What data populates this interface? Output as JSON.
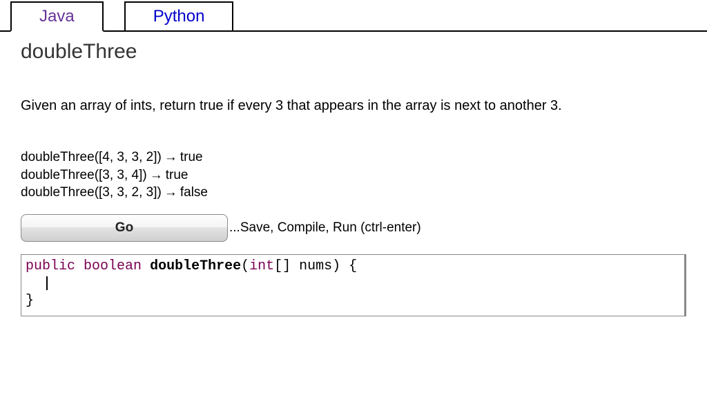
{
  "tabs": {
    "java": "Java",
    "python": "Python"
  },
  "title": "doubleThree",
  "description": "Given an array of ints, return true if every 3 that appears in the array is next to another 3.",
  "examples": [
    {
      "call": "doubleThree([4, 3, 3, 2])",
      "result": "true"
    },
    {
      "call": "doubleThree([3, 3, 4])",
      "result": "true"
    },
    {
      "call": "doubleThree([3, 3, 2, 3])",
      "result": "false"
    }
  ],
  "arrow": "→",
  "go_button": "Go",
  "hint": "...Save, Compile, Run (ctrl-enter)",
  "code": {
    "kw_public": "public",
    "kw_boolean": "boolean",
    "method_name": "doubleThree",
    "paren_open": "(",
    "kw_int": "int",
    "brackets": "[]",
    "param": " nums",
    "paren_close": ")",
    "brace_open": " {",
    "brace_close": "}"
  }
}
